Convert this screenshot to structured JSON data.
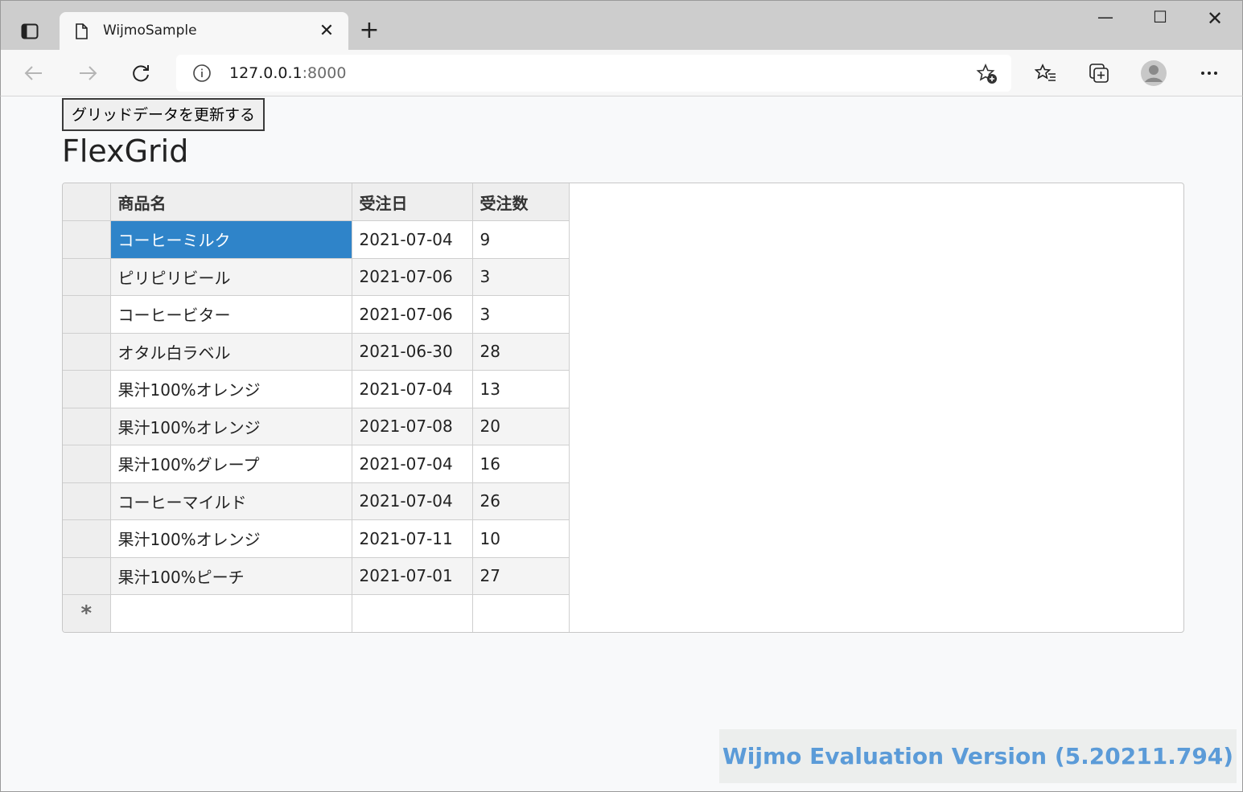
{
  "browser": {
    "tab_title": "WijmoSample",
    "new_tab": "+",
    "url_host": "127.0.0.1",
    "url_port": ":8000"
  },
  "page": {
    "update_button": "グリッドデータを更新する",
    "heading": "FlexGrid",
    "grid": {
      "columns": [
        "商品名",
        "受注日",
        "受注数"
      ],
      "rows": [
        [
          "コーヒーミルク",
          "2021-07-04",
          "9"
        ],
        [
          "ピリピリビール",
          "2021-07-06",
          "3"
        ],
        [
          "コーヒービター",
          "2021-07-06",
          "3"
        ],
        [
          "オタル白ラベル",
          "2021-06-30",
          "28"
        ],
        [
          "果汁100%オレンジ",
          "2021-07-04",
          "13"
        ],
        [
          "果汁100%オレンジ",
          "2021-07-08",
          "20"
        ],
        [
          "果汁100%グレープ",
          "2021-07-04",
          "16"
        ],
        [
          "コーヒーマイルド",
          "2021-07-04",
          "26"
        ],
        [
          "果汁100%オレンジ",
          "2021-07-11",
          "10"
        ],
        [
          "果汁100%ピーチ",
          "2021-07-01",
          "27"
        ]
      ],
      "new_row_marker": "*",
      "selected_color": "#2f84c9"
    },
    "watermark": "Wijmo Evaluation Version (5.20211.794)"
  }
}
